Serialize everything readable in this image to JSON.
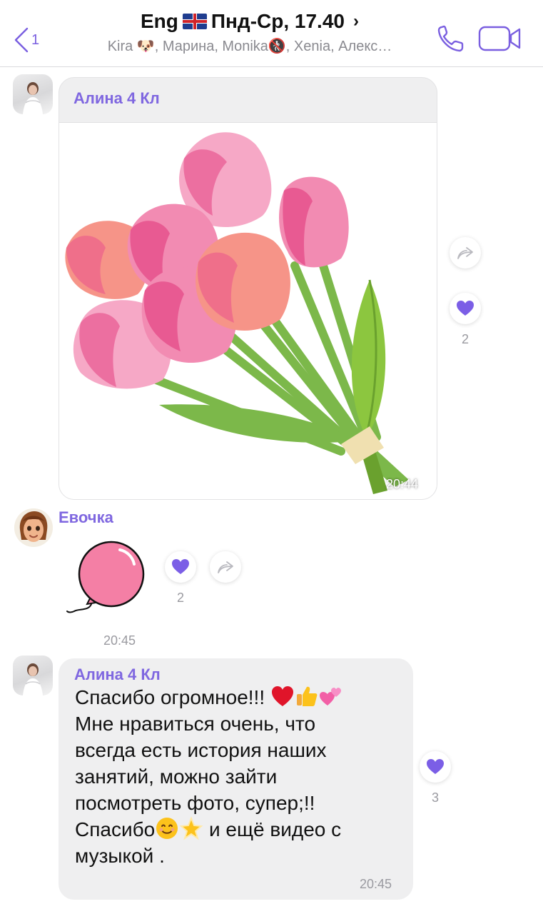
{
  "header": {
    "back_count": "1",
    "title_prefix": "Eng",
    "title_suffix": "Пнд-Ср, 17.40",
    "subtitle": "Kira 🐶, Марина, Monika🚷, Xenia, Алекс…",
    "icons": {
      "back": "chevron-left-icon",
      "call": "phone-icon",
      "video": "video-camera-icon",
      "flag": "uk-flag-icon"
    },
    "accent_color": "#7a5fe0"
  },
  "messages": [
    {
      "sender": "Алина 4 Кл",
      "type": "image",
      "image": "tulip-bouquet-sticker",
      "time": "20:44",
      "reactions": {
        "icon": "heart-icon",
        "count": "2"
      }
    },
    {
      "sender": "Евочка",
      "type": "sticker",
      "image": "pink-balloon-sticker",
      "time": "20:45",
      "reactions": {
        "icon": "heart-icon",
        "count": "2"
      }
    },
    {
      "sender": "Алина 4 Кл",
      "type": "text",
      "lines": [
        "Спасибо огромное!!! ",
        "Мне нравиться очень, что",
        "всегда есть история наших",
        "занятий, можно зайти",
        "посмотреть фото, супер;!!",
        "Спасибо",
        " и ещё видео с",
        "музыкой ."
      ],
      "time": "20:45",
      "reactions": {
        "icon": "heart-icon",
        "count": "3"
      }
    }
  ],
  "colors": {
    "bubble": "#efeff0",
    "sender": "#7f67e0",
    "heart": "#7b5ee6"
  }
}
